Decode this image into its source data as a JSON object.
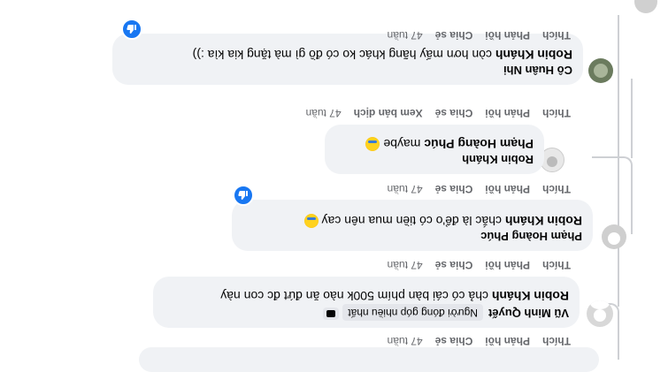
{
  "actions": {
    "like": "Thích",
    "reply": "Phản hồi",
    "share": "Chia sẻ",
    "translate": "Xem bản dịch",
    "time": "47 tuần"
  },
  "comments": [
    {
      "author": "Vũ Minh Quyết",
      "badge": "Người đóng góp nhiều nhất",
      "mention": "Robin Khánh",
      "text": " chả có cái bàn phím 500k nào ăn đứt đc con này"
    },
    {
      "author": "Phạm Hoàng Phúc",
      "mention": "Robin Khánh",
      "text": " chắc là để'o có tiền mua nên cay"
    },
    {
      "author": "Robin Khánh",
      "mention": "Phạm Hoàng Phúc",
      "text": " maybe"
    },
    {
      "author": "Cô Huân Nhi",
      "mention": "Robin Khánh",
      "text": " còn hơn mấy hãng khác ko có đồ gì mà tặng kia kìa :))"
    }
  ],
  "colors": {
    "bubble": "#f0f2f5",
    "meta": "#65676b",
    "like_blue": "#1877f2"
  },
  "icons": {
    "like_reaction": "thumbs-up-icon",
    "emoji": "emoji-icon",
    "badge": "contributor-badge-icon"
  }
}
